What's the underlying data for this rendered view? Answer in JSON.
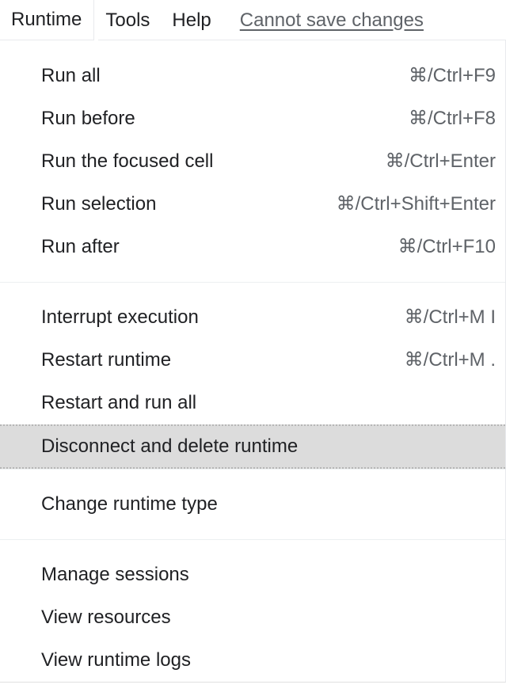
{
  "menubar": {
    "items": [
      {
        "label": "Runtime",
        "active": true
      },
      {
        "label": "Tools",
        "active": false
      },
      {
        "label": "Help",
        "active": false
      }
    ],
    "status": "Cannot save changes"
  },
  "menu": {
    "groups": [
      {
        "items": [
          {
            "label": "Run all",
            "shortcut": "⌘/Ctrl+F9",
            "focused": false
          },
          {
            "label": "Run before",
            "shortcut": "⌘/Ctrl+F8",
            "focused": false
          },
          {
            "label": "Run the focused cell",
            "shortcut": "⌘/Ctrl+Enter",
            "focused": false
          },
          {
            "label": "Run selection",
            "shortcut": "⌘/Ctrl+Shift+Enter",
            "focused": false
          },
          {
            "label": "Run after",
            "shortcut": "⌘/Ctrl+F10",
            "focused": false
          }
        ]
      },
      {
        "items": [
          {
            "label": "Interrupt execution",
            "shortcut": "⌘/Ctrl+M I",
            "focused": false
          },
          {
            "label": "Restart runtime",
            "shortcut": "⌘/Ctrl+M .",
            "focused": false
          },
          {
            "label": "Restart and run all",
            "shortcut": "",
            "focused": false
          },
          {
            "label": "Disconnect and delete runtime",
            "shortcut": "",
            "focused": true
          }
        ]
      },
      {
        "items": [
          {
            "label": "Change runtime type",
            "shortcut": "",
            "focused": false
          }
        ]
      },
      {
        "items": [
          {
            "label": "Manage sessions",
            "shortcut": "",
            "focused": false
          },
          {
            "label": "View resources",
            "shortcut": "",
            "focused": false
          },
          {
            "label": "View runtime logs",
            "shortcut": "",
            "focused": false
          }
        ]
      }
    ]
  }
}
